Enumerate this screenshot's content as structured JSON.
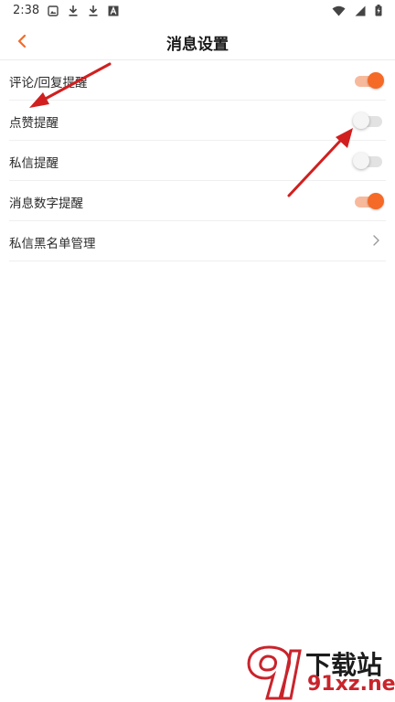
{
  "status_bar": {
    "time": "2:38",
    "left_icons": [
      "gallery-icon",
      "download-icon",
      "download-icon",
      "font-icon"
    ],
    "right_icons": [
      "wifi-icon",
      "signal-icon",
      "battery-charging-icon"
    ]
  },
  "header": {
    "title": "消息设置",
    "back_icon": "back-arrow-icon",
    "accent_color": "#f56a27"
  },
  "settings": {
    "items": [
      {
        "label": "评论/回复提醒",
        "type": "toggle",
        "checked": true
      },
      {
        "label": "点赞提醒",
        "type": "toggle",
        "checked": false
      },
      {
        "label": "私信提醒",
        "type": "toggle",
        "checked": false
      },
      {
        "label": "消息数字提醒",
        "type": "toggle",
        "checked": true
      },
      {
        "label": "私信黑名单管理",
        "type": "link",
        "icon": "chevron-right-icon"
      }
    ]
  },
  "annotations": {
    "arrow_color": "#d11f1f",
    "arrows": [
      "arrow-to-comment-reply-row",
      "arrow-to-like-toggle"
    ]
  },
  "watermark": {
    "cn": "下载站",
    "site": "91xz.net",
    "color": "#c9242b"
  }
}
